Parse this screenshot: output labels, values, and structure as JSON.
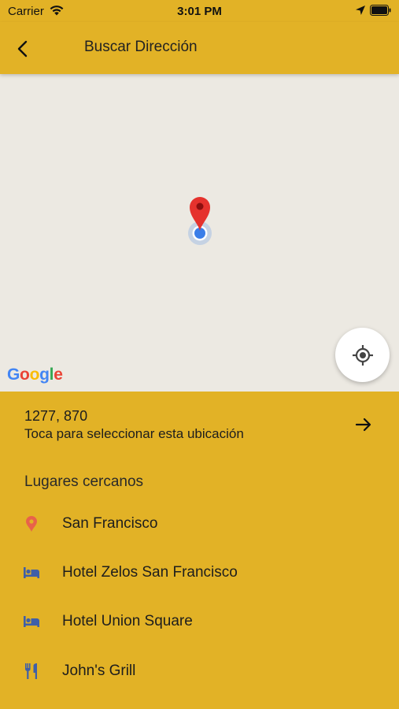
{
  "status_bar": {
    "carrier": "Carrier",
    "time": "3:01 PM"
  },
  "app_bar": {
    "title": "Buscar Dirección"
  },
  "map": {
    "logo_letters": [
      "G",
      "o",
      "o",
      "g",
      "l",
      "e"
    ],
    "logo_colors": [
      "#4285F4",
      "#EA4335",
      "#FBBC05",
      "#4285F4",
      "#34A853",
      "#EA4335"
    ],
    "background_color": "#ece9e2",
    "pin_color": "#e5322d",
    "location_dot_color": "#3b7ee8"
  },
  "selection": {
    "coordinates": "1277, 870",
    "hint": "Toca para seleccionar esta ubicación"
  },
  "nearby": {
    "heading": "Lugares cercanos",
    "places": [
      {
        "label": "San Francisco",
        "icon": "place-pin-icon",
        "icon_color": "#e8624a"
      },
      {
        "label": "Hotel Zelos San Francisco",
        "icon": "hotel-bed-icon",
        "icon_color": "#3f5fa8"
      },
      {
        "label": "Hotel Union Square",
        "icon": "hotel-bed-icon",
        "icon_color": "#3f5fa8"
      },
      {
        "label": "John's Grill",
        "icon": "restaurant-icon",
        "icon_color": "#3f5fa8"
      }
    ]
  },
  "colors": {
    "accent": "#e2b226",
    "text": "#1d1d1d"
  }
}
